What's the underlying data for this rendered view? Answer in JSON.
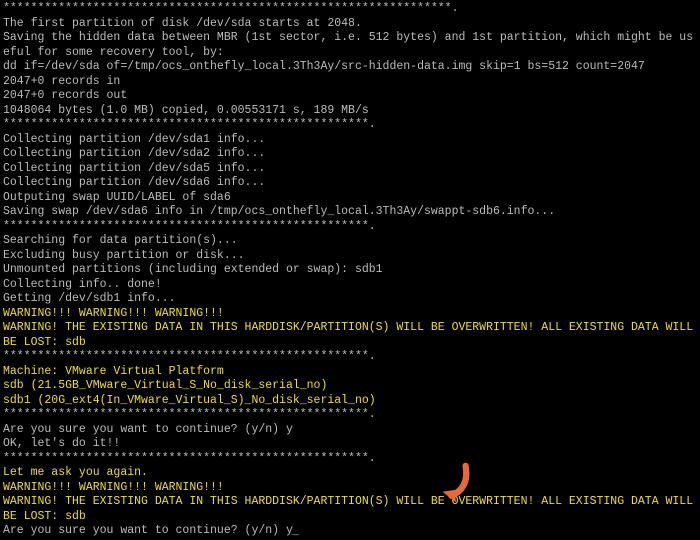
{
  "lines": [
    {
      "t": "*****************************************************************.",
      "c": "white"
    },
    {
      "t": "The first partition of disk /dev/sda starts at 2048.",
      "c": "white"
    },
    {
      "t": "Saving the hidden data between MBR (1st sector, i.e. 512 bytes) and 1st partition, which might be useful for some recovery tool, by:",
      "c": "white"
    },
    {
      "t": "dd if=/dev/sda of=/tmp/ocs_onthefly_local.3Th3Ay/src-hidden-data.img skip=1 bs=512 count=2047",
      "c": "white"
    },
    {
      "t": "2047+0 records in",
      "c": "white"
    },
    {
      "t": "2047+0 records out",
      "c": "white"
    },
    {
      "t": "1048064 bytes (1.0 MB) copied, 0.00553171 s, 189 MB/s",
      "c": "white"
    },
    {
      "t": "*****************************************************.",
      "c": "white"
    },
    {
      "t": "Collecting partition /dev/sda1 info...",
      "c": "white"
    },
    {
      "t": "Collecting partition /dev/sda2 info...",
      "c": "white"
    },
    {
      "t": "Collecting partition /dev/sda5 info...",
      "c": "white"
    },
    {
      "t": "Collecting partition /dev/sda6 info...",
      "c": "white"
    },
    {
      "t": "Outputing swap UUID/LABEL of sda6",
      "c": "white"
    },
    {
      "t": "Saving swap /dev/sda6 info in /tmp/ocs_onthefly_local.3Th3Ay/swappt-sdb6.info...",
      "c": "white"
    },
    {
      "t": "*****************************************************.",
      "c": "white"
    },
    {
      "t": "Searching for data partition(s)...",
      "c": "white"
    },
    {
      "t": "Excluding busy partition or disk...",
      "c": "white"
    },
    {
      "t": "Unmounted partitions (including extended or swap): sdb1",
      "c": "white"
    },
    {
      "t": "Collecting info.. done!",
      "c": "white"
    },
    {
      "t": "Getting /dev/sdb1 info...",
      "c": "white"
    },
    {
      "t": "WARNING!!! WARNING!!! WARNING!!!",
      "c": "yellow"
    },
    {
      "t": "WARNING! THE EXISTING DATA IN THIS HARDDISK/PARTITION(S) WILL BE OVERWRITTEN! ALL EXISTING DATA WILL BE LOST: sdb",
      "c": "yellow"
    },
    {
      "t": "*****************************************************.",
      "c": "white"
    },
    {
      "t": "Machine: VMware Virtual Platform",
      "c": "yellow"
    },
    {
      "t": "sdb (21.5GB_VMware_Virtual_S_No_disk_serial_no)",
      "c": "yellow"
    },
    {
      "t": "sdb1 (20G_ext4(In_VMware_Virtual_S)_No_disk_serial_no)",
      "c": "yellow"
    },
    {
      "t": "*****************************************************.",
      "c": "white"
    },
    {
      "t": "Are you sure you want to continue? (y/n) y",
      "c": "white"
    },
    {
      "t": "OK, let's do it!!",
      "c": "white"
    },
    {
      "t": "*****************************************************.",
      "c": "white"
    },
    {
      "t": "Let me ask you again.",
      "c": "yellow"
    },
    {
      "t": "WARNING!!! WARNING!!! WARNING!!!",
      "c": "yellow"
    },
    {
      "t": "WARNING! THE EXISTING DATA IN THIS HARDDISK/PARTITION(S) WILL BE OVERWRITTEN! ALL EXISTING DATA WILL BE LOST: sdb",
      "c": "yellow"
    }
  ],
  "prompt": {
    "text": "Are you sure you want to continue? (y/n) y",
    "c": "white"
  },
  "arrow_color": "#e36a3a"
}
